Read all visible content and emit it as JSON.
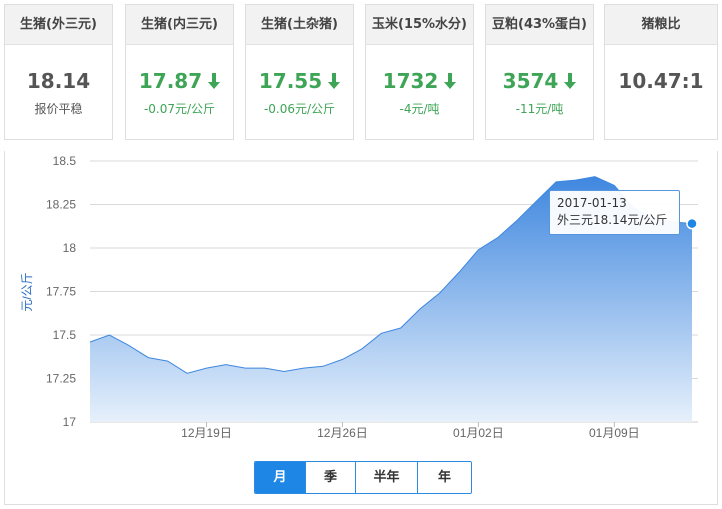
{
  "cards": [
    {
      "title": "生猪(外三元)",
      "value": "18.14",
      "sub": "报价平稳",
      "trend": "flat",
      "active": true
    },
    {
      "title": "生猪(内三元)",
      "value": "17.87",
      "sub": "-0.07元/公斤",
      "trend": "down",
      "active": false
    },
    {
      "title": "生猪(土杂猪)",
      "value": "17.55",
      "sub": "-0.06元/公斤",
      "trend": "down",
      "active": false
    },
    {
      "title": "玉米(15%水分)",
      "value": "1732",
      "sub": "-4元/吨",
      "trend": "down",
      "active": false
    },
    {
      "title": "豆粕(43%蛋白)",
      "value": "3574",
      "sub": "-11元/吨",
      "trend": "down",
      "active": false
    },
    {
      "title": "猪粮比",
      "value": "10.47:1",
      "sub": "",
      "trend": "flat",
      "active": false
    }
  ],
  "colors": {
    "accent": "#1e87e5",
    "down": "#3ea556",
    "area_top": "#3f87df",
    "area_bottom": "#e6f0fb",
    "line": "#3f87df"
  },
  "tooltip": {
    "date": "2017-01-13",
    "text": "外三元18.14元/公斤"
  },
  "range_tabs": [
    "月",
    "季",
    "半年",
    "年"
  ],
  "range_selected": 0,
  "chart_data": {
    "type": "area",
    "ylabel": "元/公斤",
    "xlabel": "",
    "ylim": [
      17,
      18.5
    ],
    "yticks": [
      17,
      17.25,
      17.5,
      17.75,
      18,
      18.25,
      18.5
    ],
    "ytick_labels": [
      "17",
      "17.25",
      "17.5",
      "17.75",
      "18",
      "18.25",
      "18.5"
    ],
    "xtick_labels": [
      "12月19日",
      "12月26日",
      "01月02日",
      "01月09日"
    ],
    "xtick_index": [
      6,
      13,
      20,
      27
    ],
    "grid": true,
    "series": [
      {
        "name": "外三元",
        "x": [
          "12-13",
          "12-14",
          "12-15",
          "12-16",
          "12-17",
          "12-18",
          "12-19",
          "12-20",
          "12-21",
          "12-22",
          "12-23",
          "12-24",
          "12-25",
          "12-26",
          "12-27",
          "12-28",
          "12-29",
          "12-30",
          "12-31",
          "01-01",
          "01-02",
          "01-03",
          "01-04",
          "01-05",
          "01-06",
          "01-07",
          "01-08",
          "01-09",
          "01-10",
          "01-11",
          "01-12",
          "01-13"
        ],
        "values": [
          17.46,
          17.5,
          17.44,
          17.37,
          17.35,
          17.28,
          17.31,
          17.33,
          17.31,
          17.31,
          17.29,
          17.31,
          17.32,
          17.36,
          17.42,
          17.51,
          17.54,
          17.65,
          17.74,
          17.86,
          17.99,
          18.06,
          18.16,
          18.27,
          18.38,
          18.39,
          18.41,
          18.36,
          18.23,
          18.17,
          18.15,
          18.14
        ]
      }
    ]
  }
}
